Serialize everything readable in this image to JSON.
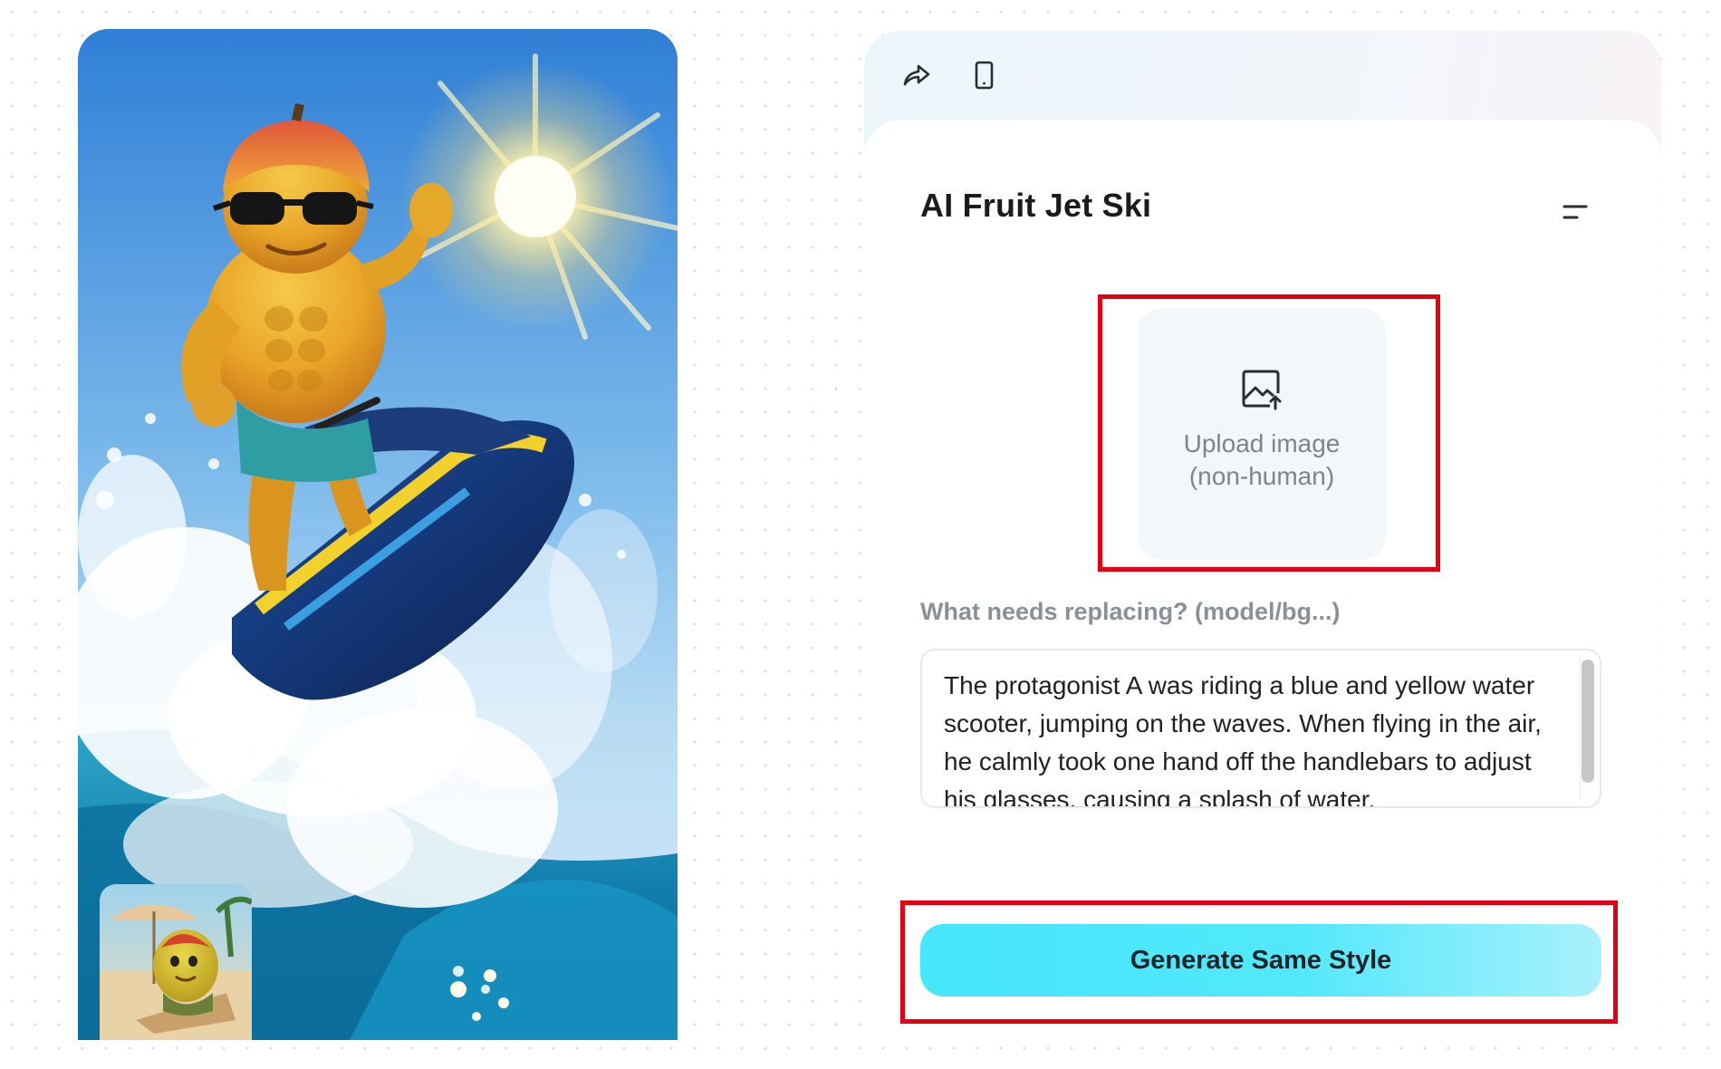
{
  "panel": {
    "title": "AI Fruit Jet Ski",
    "upload": {
      "line1": "Upload image",
      "line2": "(non-human)"
    },
    "prompt_label": "What needs replacing? (model/bg...)",
    "prompt_text": "The protagonist A was riding a blue and yellow water scooter, jumping on the waves. When flying in the air, he calmly took one hand off the handlebars to adjust his glasses, causing a splash of water.",
    "generate_label": "Generate Same Style"
  },
  "toolbar": {
    "items": [
      {
        "icon": "share-icon"
      },
      {
        "icon": "phone-icon"
      }
    ]
  },
  "preview": {
    "image": "mango character riding a jet ski over a wave",
    "thumbnail": "mango character relaxing on a beach chair"
  },
  "colors": {
    "accent": "#46e6fb",
    "annotation": "#e60012",
    "title": "#1b1b1f",
    "muted": "#8a9098"
  }
}
